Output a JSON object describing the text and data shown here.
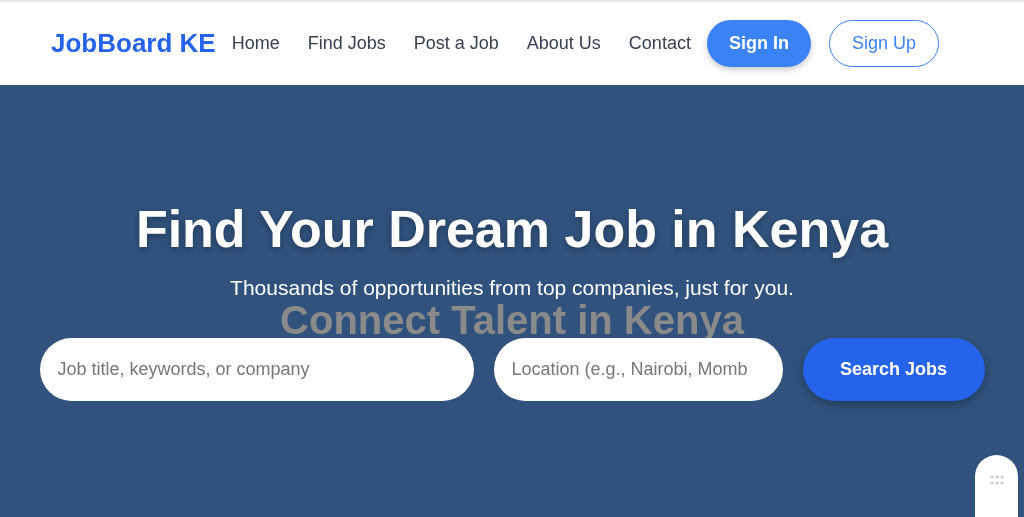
{
  "header": {
    "logo": "JobBoard KE",
    "nav": [
      {
        "label": "Home"
      },
      {
        "label": "Find Jobs"
      },
      {
        "label": "Post a Job"
      },
      {
        "label": "About Us"
      },
      {
        "label": "Contact"
      }
    ],
    "sign_in": "Sign In",
    "sign_up": "Sign Up"
  },
  "hero": {
    "title": "Find Your Dream Job in Kenya",
    "subtitle": "Thousands of opportunities from top companies, just for you.",
    "background_text": "Connect Talent in Kenya",
    "search": {
      "keyword_placeholder": "Job title, keywords, or company",
      "location_placeholder": "Location (e.g., Nairobi, Momb",
      "button": "Search Jobs"
    }
  }
}
